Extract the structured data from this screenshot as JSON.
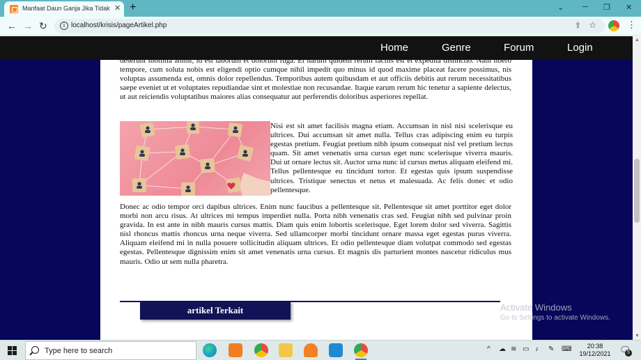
{
  "browser": {
    "tab_title": "Manfaat Daun Ganja Jika Tidak d",
    "tab_close": "✕",
    "new_tab": "+",
    "url": "localhost/krisis/pageArtikel.php",
    "back": "←",
    "forward": "→",
    "reload": "↻",
    "minimize": "─",
    "restore": "❐",
    "close": "✕",
    "collapse": "⌄",
    "info_glyph": "i",
    "share_glyph": "⇪",
    "star_glyph": "☆",
    "menu_glyph": "⋮"
  },
  "nav": {
    "home": "Home",
    "genre": "Genre",
    "forum": "Forum",
    "login": "Login"
  },
  "article": {
    "para1": "deserunt mollitia animi, id est laborum et dolorum fuga. Et harum quidem rerum facilis est et expedita distinctio. Nam libero tempore, cum soluta nobis est eligendi optio cumque nihil impedit quo minus id quod maxime placeat facere possimus, nis voluptas assumenda est, omnis dolor repellendus. Temporibus autem quibusdam et aut officiis debitis aut rerum necessitatibus saepe eveniet ut et voluptates repudiandae sint et molestiae non recusandae. Itaque earum rerum hic tenetur a sapiente delectus, ut aut reiciendis voluptatibus maiores alias consequatur aut perferendis doloribus asperiores repellat.",
    "para2": "Nisi est sit amet facilisis magna etiam. Accumsan in nisl nisi scelerisque eu ultrices. Dui accumsan sit amet nulla. Tellus cras adipiscing enim eu turpis egestas pretium. Feugiat pretium nibh ipsum consequat nisl vel pretium lectus quam. Sit amet venenatis urna cursus eget nunc scelerisque viverra mauris. Dui ut ornare lectus sit. Auctor urna nunc id cursus metus aliquam eleifend mi. Tellus pellentesque eu tincidunt tortor. Et egestas quis ipsum suspendisse ultrices. Tristique senectus et netus et malesuada. Ac felis donec et odio pellentesque.",
    "para3": "Donec ac odio tempor orci dapibus ultrices. Enim nunc faucibus a pellentesque sit. Pellentesque sit amet porttitor eget dolor morbi non arcu risus. At ultrices mi tempus imperdiet nulla. Porta nibh venenatis cras sed. Feugiat nibh sed pulvinar proin gravida. In est ante in nibh mauris cursus mattis. Diam quis enim lobortis scelerisque. Eget lorem dolor sed viverra. Sagittis nisl rhoncus mattis rhoncus urna neque viverra. Sed ullamcorper morbi tincidunt ornare massa eget egestas purus viverra. Aliquam eleifend mi in nulla posuere sollicitudin aliquam ultrices. Et odio pellentesque diam volutpat commodo sed egestas egestas. Pellentesque dignissim enim sit amet venenatis urna cursus. Et magnis dis parturient montes nascetur ridiculus mus mauris. Odio ut sem nulla pharetra.",
    "related_label": "artikel Terkait"
  },
  "watermark": {
    "title": "Activate Windows",
    "subtitle": "Go to Settings to activate Windows."
  },
  "taskbar": {
    "search_placeholder": "Type here to search",
    "time": "20:38",
    "date": "19/12/2021",
    "notification_count": "5",
    "tray_chevron": "^",
    "notification_glyph": "🗨"
  },
  "colors": {
    "page_background": "#06065a",
    "navbar": "#121212",
    "accent": "#121256",
    "browser_frame": "#5fb7c4"
  }
}
